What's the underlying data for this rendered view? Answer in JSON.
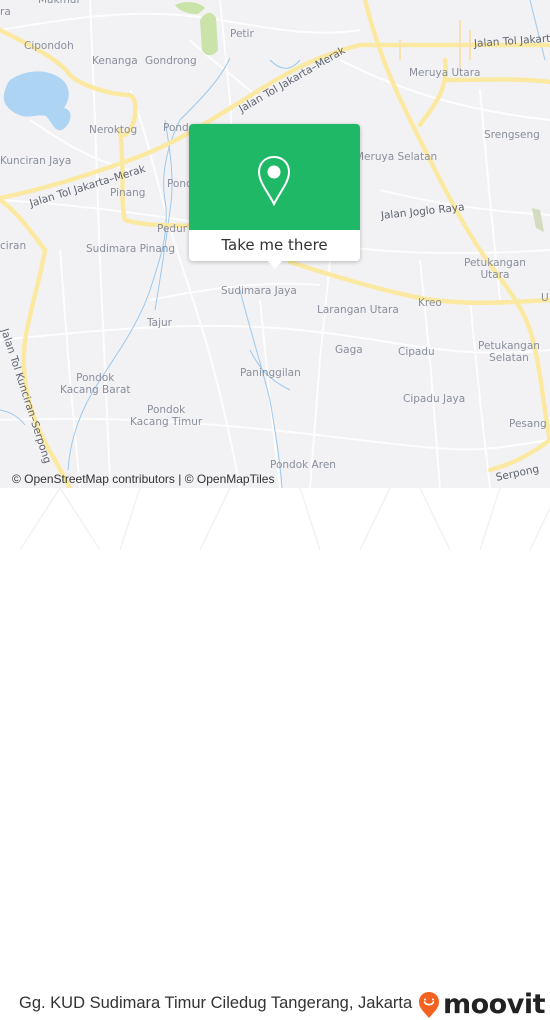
{
  "map": {
    "place_labels": [
      {
        "id": "cipondoh",
        "text": "Cipondoh"
      },
      {
        "id": "kenanga",
        "text": "Kenanga"
      },
      {
        "id": "gondrong",
        "text": "Gondrong"
      },
      {
        "id": "petir",
        "text": "Petir"
      },
      {
        "id": "meruya-utara",
        "text": "Meruya Utara"
      },
      {
        "id": "neroktog",
        "text": "Neroktog"
      },
      {
        "id": "pondok-1",
        "text": "Pond"
      },
      {
        "id": "srengseng",
        "text": "Srengseng"
      },
      {
        "id": "kunciran-jaya",
        "text": "Kunciran Jaya"
      },
      {
        "id": "meruya-selatan",
        "text": "Meruya Selatan"
      },
      {
        "id": "pinang",
        "text": "Pinang"
      },
      {
        "id": "pondok-2",
        "text": "Ponc"
      },
      {
        "id": "pedurenan",
        "text": "Pedur"
      },
      {
        "id": "kunciran",
        "text": "ciran"
      },
      {
        "id": "sudimara-pinang",
        "text": "Sudimara Pinang"
      },
      {
        "id": "petukangan-utara",
        "text": "Petukangan\nUtara"
      },
      {
        "id": "sudimara-jaya",
        "text": "Sudimara Jaya"
      },
      {
        "id": "kreo",
        "text": "Kreo"
      },
      {
        "id": "larangan-utara",
        "text": "Larangan Utara"
      },
      {
        "id": "tajur",
        "text": "Tajur"
      },
      {
        "id": "gaga",
        "text": "Gaga"
      },
      {
        "id": "cipadu",
        "text": "Cipadu"
      },
      {
        "id": "petukangan-selatan",
        "text": "Petukangan\nSelatan"
      },
      {
        "id": "paninggilan",
        "text": "Paninggilan"
      },
      {
        "id": "pondok-kacang-barat",
        "text": "Pondok\nKacang Barat"
      },
      {
        "id": "pondok-kacang-timur",
        "text": "Pondok\nKacang Timur"
      },
      {
        "id": "cipadu-jaya",
        "text": "Cipadu Jaya"
      },
      {
        "id": "pesanggrahan",
        "text": "Pesang"
      },
      {
        "id": "pondok-aren",
        "text": "Pondok Aren"
      },
      {
        "id": "u-edge",
        "text": "U"
      },
      {
        "id": "mekar-top",
        "text": "Makmur"
      },
      {
        "id": "top-left-ra",
        "text": "ra"
      }
    ],
    "road_labels": [
      {
        "id": "tol-jakarta-merak-west",
        "text": "Jalan Tol Jakarta–Merak"
      },
      {
        "id": "tol-jakarta-merak-mid",
        "text": "Jalan Tol Jakarta–Merak"
      },
      {
        "id": "tol-jakarta-east",
        "text": "Jalan Tol Jakart"
      },
      {
        "id": "jalan-joglo-raya",
        "text": "Jalan Joglo Raya"
      },
      {
        "id": "tol-kunciran-serpong",
        "text": "Jalan Tol Kunciran–Serpong"
      },
      {
        "id": "serpong",
        "text": "Serpong"
      }
    ],
    "attribution": "© OpenStreetMap contributors | © OpenMapTiles"
  },
  "popup": {
    "icon": "map-pin-icon",
    "button_label": "Take me there",
    "color": "#1fb866"
  },
  "footer": {
    "title": "Gg. KUD Sudimara Timur Ciledug Tangerang, Jakarta",
    "brand": "moovit",
    "brand_color": "#f26322"
  }
}
